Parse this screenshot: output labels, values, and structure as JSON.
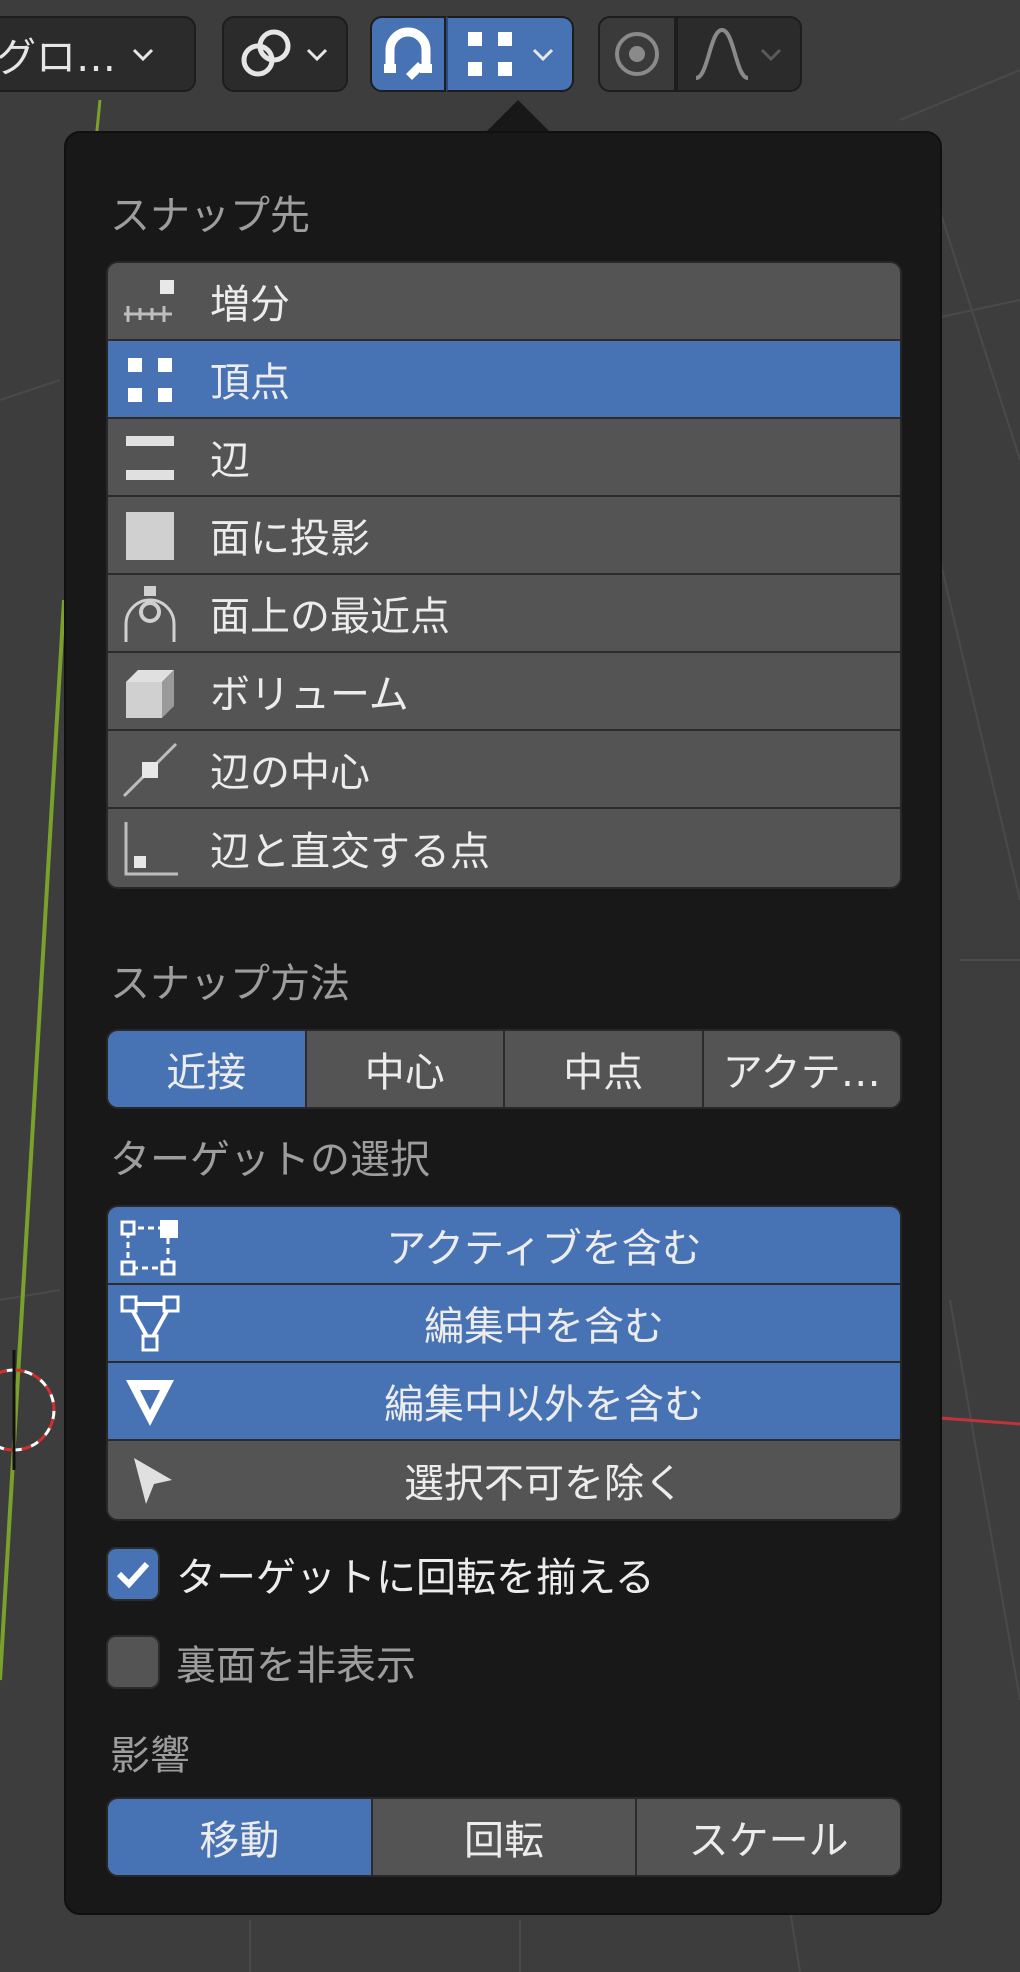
{
  "header": {
    "orientation_label": "グロ…",
    "pivot_icon": "link-rings-icon",
    "snap_icon": "magnet-icon",
    "snap_target_icon": "vertex-grid-icon",
    "proportional_icon": "circle-dot-icon",
    "falloff_icon": "falloff-curve-icon"
  },
  "popover": {
    "snap_to": {
      "title": "スナップ先",
      "items": [
        {
          "label": "増分",
          "icon": "increment-icon",
          "active": false
        },
        {
          "label": "頂点",
          "icon": "vertex-icon",
          "active": true
        },
        {
          "label": "辺",
          "icon": "edge-icon",
          "active": false
        },
        {
          "label": "面に投影",
          "icon": "face-project-icon",
          "active": false
        },
        {
          "label": "面上の最近点",
          "icon": "face-nearest-icon",
          "active": false
        },
        {
          "label": "ボリューム",
          "icon": "volume-icon",
          "active": false
        },
        {
          "label": "辺の中心",
          "icon": "edge-midpoint-icon",
          "active": false
        },
        {
          "label": "辺と直交する点",
          "icon": "edge-perpendicular-icon",
          "active": false
        }
      ]
    },
    "snap_method": {
      "title": "スナップ方法",
      "options": [
        {
          "label": "近接",
          "active": true
        },
        {
          "label": "中心",
          "active": false
        },
        {
          "label": "中点",
          "active": false
        },
        {
          "label": "アクテ…",
          "active": false
        }
      ]
    },
    "target_selection": {
      "title": "ターゲットの選択",
      "items": [
        {
          "label": "アクティブを含む",
          "icon": "active-select-icon",
          "active": true
        },
        {
          "label": "編集中を含む",
          "icon": "edit-mesh-icon",
          "active": true
        },
        {
          "label": "編集中以外を含む",
          "icon": "non-edit-triangle-icon",
          "active": true
        },
        {
          "label": "選択不可を除く",
          "icon": "cursor-arrow-icon",
          "active": false
        }
      ]
    },
    "align_rotation": {
      "label": "ターゲットに回転を揃える",
      "checked": true
    },
    "backface_culling": {
      "label": "裏面を非表示",
      "checked": false
    },
    "affect": {
      "title": "影響",
      "options": [
        {
          "label": "移動",
          "active": true
        },
        {
          "label": "回転",
          "active": false
        },
        {
          "label": "スケール",
          "active": false
        }
      ]
    }
  },
  "colors": {
    "accent": "#4772b3",
    "button": "#545454",
    "panel": "#181818",
    "viewport": "#3d3d3d",
    "axis_y": "#7aa12a",
    "axis_x": "#c0333a"
  }
}
